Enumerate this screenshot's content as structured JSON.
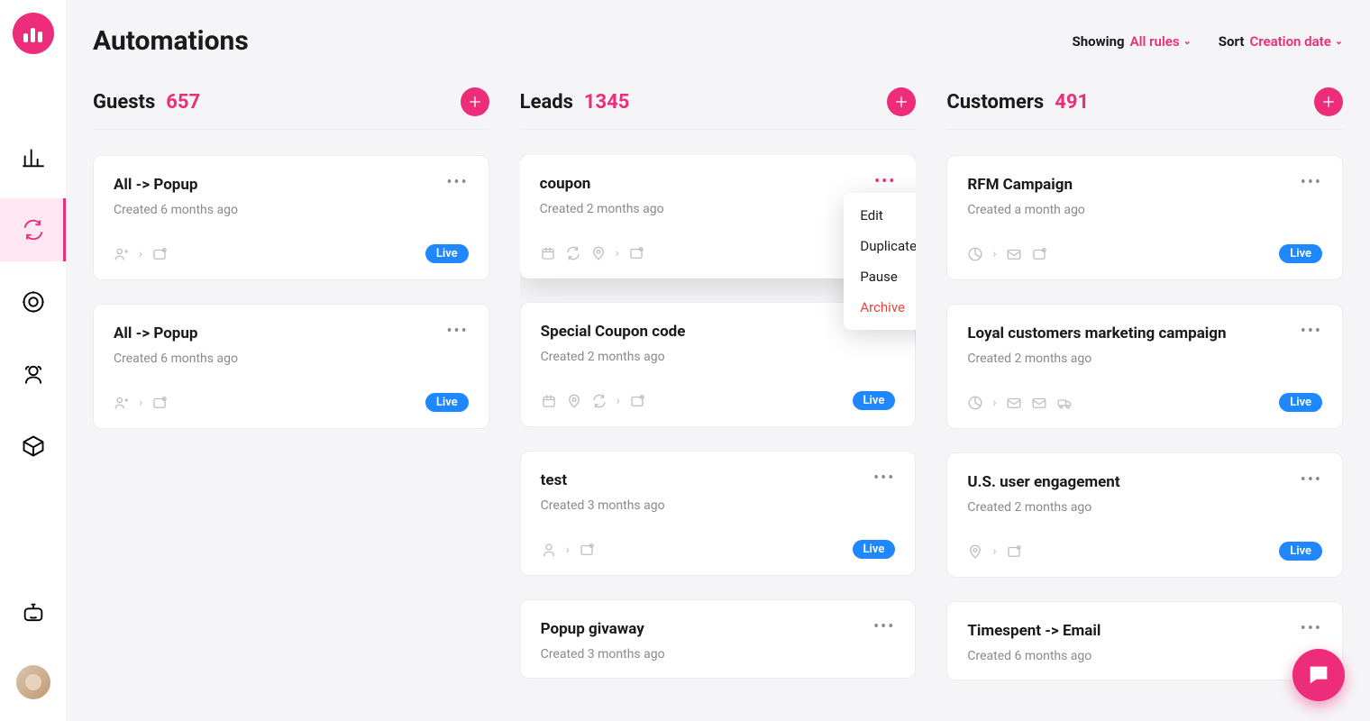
{
  "page": {
    "title": "Automations"
  },
  "filters": {
    "showing": {
      "label": "Showing",
      "value": "All rules"
    },
    "sort": {
      "label": "Sort",
      "value": "Creation date"
    }
  },
  "menu": {
    "edit": "Edit",
    "duplicate": "Duplicate",
    "pause": "Pause",
    "archive": "Archive"
  },
  "live_label": "Live",
  "columns": [
    {
      "title": "Guests",
      "count": "657",
      "cards": [
        {
          "title": "All -> Popup",
          "created": "Created 6 months ago",
          "icons": "user>popup",
          "elevated": false
        },
        {
          "title": "All -> Popup",
          "created": "Created 6 months ago",
          "icons": "user>popup",
          "elevated": false
        }
      ]
    },
    {
      "title": "Leads",
      "count": "1345",
      "cards": [
        {
          "title": "coupon",
          "created": "Created 2 months ago",
          "icons": "cal,refresh,pin>popup",
          "elevated": true,
          "menu": true
        },
        {
          "title": "Special Coupon code",
          "created": "Created 2 months ago",
          "icons": "cal,pin,refresh>popup",
          "elevated": false
        },
        {
          "title": "test",
          "created": "Created 3 months ago",
          "icons": "person>popup",
          "elevated": false
        },
        {
          "title": "Popup givaway",
          "created": "Created 3 months ago",
          "icons": "",
          "elevated": false,
          "nofoot": true
        }
      ]
    },
    {
      "title": "Customers",
      "count": "491",
      "cards": [
        {
          "title": "RFM Campaign",
          "created": "Created a month ago",
          "icons": "pie>mail,popup",
          "elevated": false
        },
        {
          "title": "Loyal customers marketing campaign",
          "created": "Created 2 months ago",
          "icons": "pie>mail,mail,truck",
          "elevated": false
        },
        {
          "title": "U.S. user engagement",
          "created": "Created 2 months ago",
          "icons": "pin>popup",
          "elevated": false
        },
        {
          "title": "Timespent -> Email",
          "created": "Created 6 months ago",
          "icons": "",
          "elevated": false,
          "nofoot": true
        }
      ]
    }
  ]
}
